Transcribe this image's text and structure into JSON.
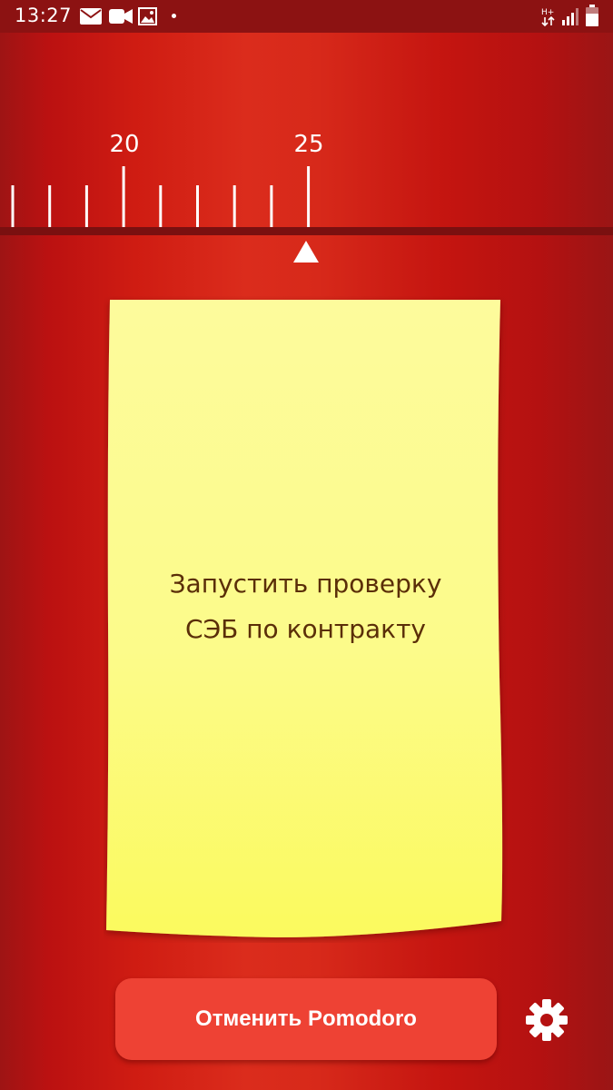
{
  "status_bar": {
    "time": "13:27",
    "left_icons": [
      "mail-icon",
      "video-icon",
      "image-icon"
    ],
    "right_icons": [
      "data-transfer-icon",
      "signal-icon",
      "battery-icon"
    ]
  },
  "timer_ruler": {
    "labels": [
      {
        "value": "20",
        "tick_index": 3
      },
      {
        "value": "25",
        "tick_index": 8
      }
    ],
    "selected_minutes": 25
  },
  "task": {
    "text": "Запустить проверку СЭБ по контракту"
  },
  "actions": {
    "cancel_label": "Отменить Pomodoro",
    "settings_icon": "gear-icon"
  },
  "colors": {
    "background": "#c8140f",
    "status_bar": "#8c1212",
    "sticky_note": "#fdfc86",
    "button": "#ee4234",
    "text": "#5a2e08"
  }
}
